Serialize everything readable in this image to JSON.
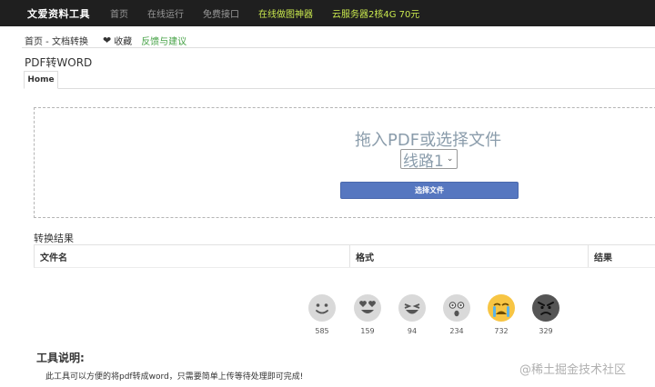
{
  "nav": {
    "brand": "文爱资料工具",
    "links": [
      "首页",
      "在线运行",
      "免费接口"
    ],
    "highlights": [
      "在线做图神器",
      "云服务器2核4G 70元"
    ]
  },
  "breadcrumb": {
    "path": "首页 - 文档转换",
    "favorite": "收藏",
    "feedback": "反馈与建议"
  },
  "page_title": "PDF转WORD",
  "tabs": [
    "Home"
  ],
  "dropzone": {
    "title": "拖入PDF或选择文件",
    "route_selected": "线路1",
    "choose_button": "选择文件"
  },
  "results": {
    "title": "转换结果",
    "columns": [
      "文件名",
      "格式",
      "结果"
    ]
  },
  "reactions": [
    {
      "icon": "smile-icon",
      "count": "585"
    },
    {
      "icon": "heart-eyes-icon",
      "count": "159"
    },
    {
      "icon": "laugh-icon",
      "count": "94"
    },
    {
      "icon": "surprised-icon",
      "count": "234"
    },
    {
      "icon": "crying-icon",
      "count": "732"
    },
    {
      "icon": "angry-icon",
      "count": "329"
    }
  ],
  "tools": {
    "heading": "工具说明:",
    "description": "此工具可以方便的将pdf转成word，只需要简单上传等待处理即可完成!"
  },
  "watermark": "@稀土掘金技术社区",
  "colors": {
    "nav_bg": "#1f1f1f",
    "nav_highlight": "#c9e84e",
    "feedback": "#46a246",
    "button": "#5677c0"
  }
}
